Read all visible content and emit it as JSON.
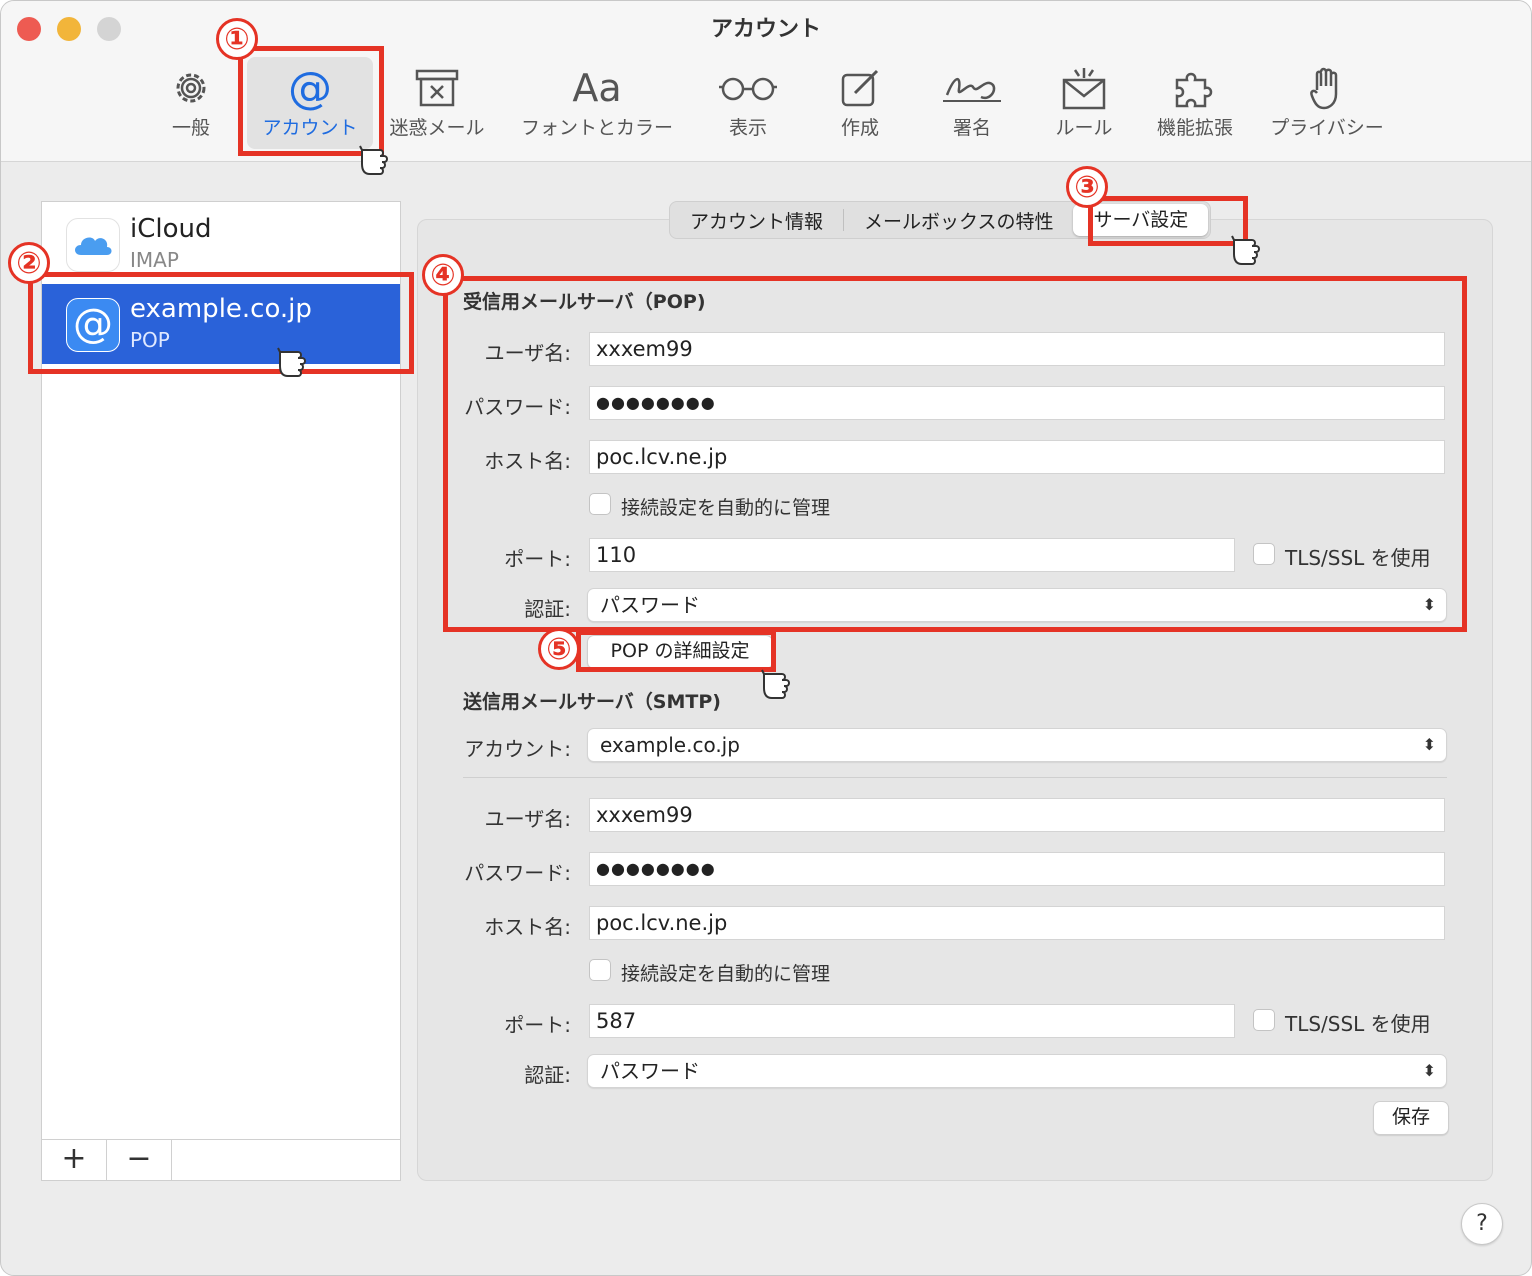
{
  "window": {
    "title": "アカウント"
  },
  "toolbar": {
    "items": [
      {
        "label": "一般",
        "icon": "gear-icon"
      },
      {
        "label": "アカウント",
        "icon": "at-sign-icon",
        "active": true
      },
      {
        "label": "迷惑メール",
        "icon": "junk-bin-icon"
      },
      {
        "label": "フォントとカラー",
        "icon": "font-icon",
        "glyph": "Aa"
      },
      {
        "label": "表示",
        "icon": "glasses-icon"
      },
      {
        "label": "作成",
        "icon": "compose-icon"
      },
      {
        "label": "署名",
        "icon": "signature-icon"
      },
      {
        "label": "ルール",
        "icon": "rules-envelope-icon"
      },
      {
        "label": "機能拡張",
        "icon": "puzzle-icon"
      },
      {
        "label": "プライバシー",
        "icon": "hand-icon"
      }
    ]
  },
  "sidebar": {
    "accounts": [
      {
        "name": "iCloud",
        "type": "IMAP",
        "icon": "icloud-icon"
      },
      {
        "name": "example.co.jp",
        "type": "POP",
        "icon": "at-sign-icon",
        "selected": true
      }
    ],
    "add_label": "+",
    "remove_label": "−"
  },
  "tabs": [
    "アカウント情報",
    "メールボックスの特性",
    "サーバ設定"
  ],
  "incoming": {
    "title": "受信用メールサーバ（POP)",
    "username_label": "ユーザ名:",
    "username": "xxxem99",
    "password_label": "パスワード:",
    "password": "●●●●●●●●",
    "host_label": "ホスト名:",
    "host": "poc.lcv.ne.jp",
    "auto_manage": "接続設定を自動的に管理",
    "port_label": "ポート:",
    "port": "110",
    "tls": "TLS/SSL を使用",
    "auth_label": "認証:",
    "auth": "パスワード",
    "advanced_button": "POP の詳細設定"
  },
  "outgoing": {
    "title": "送信用メールサーバ（SMTP)",
    "account_label": "アカウント:",
    "account": "example.co.jp",
    "username_label": "ユーザ名:",
    "username": "xxxem99",
    "password_label": "パスワード:",
    "password": "●●●●●●●●",
    "host_label": "ホスト名:",
    "host": "poc.lcv.ne.jp",
    "auto_manage": "接続設定を自動的に管理",
    "port_label": "ポート:",
    "port": "587",
    "tls": "TLS/SSL を使用",
    "auth_label": "認証:",
    "auth": "パスワード"
  },
  "save_button": "保存",
  "help_button": "?",
  "step_markers": [
    "①",
    "②",
    "③",
    "④",
    "⑤"
  ],
  "colors": {
    "highlight": "#e53325",
    "selection": "#2a62d9",
    "accent": "#1f6ce0"
  }
}
